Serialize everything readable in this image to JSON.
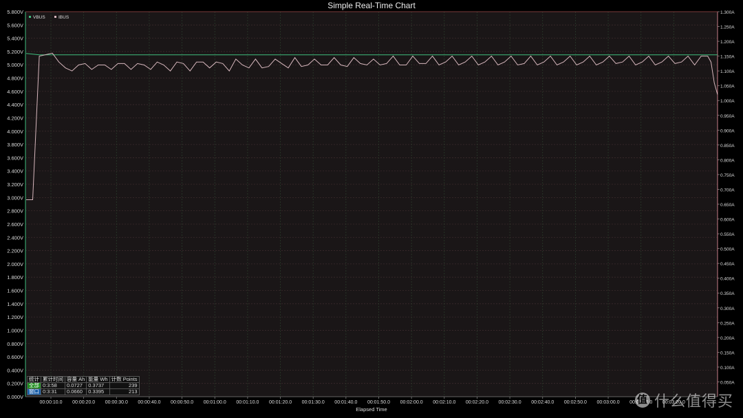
{
  "chart_data": {
    "type": "line",
    "title": "Simple Real-Time Chart",
    "xlabel": "Elapsed Time",
    "x_ticks": [
      "00:00:10.0",
      "00:00:20.0",
      "00:00:30.0",
      "00:00:40.0",
      "00:00:50.0",
      "00:01:00.0",
      "00:01:10.0",
      "00:01:20.0",
      "00:01:30.0",
      "00:01:40.0",
      "00:01:50.0",
      "00:02:00.0",
      "00:02:10.0",
      "00:02:20.0",
      "00:02:30.0",
      "00:02:40.0",
      "00:02:50.0",
      "00:03:00.0",
      "00:03:10.0",
      "00:03:20.0"
    ],
    "xlim": [
      0,
      211
    ],
    "left_axis": {
      "ylim": [
        0,
        5.8
      ],
      "ticks": [
        "0.000V",
        "0.200V",
        "0.400V",
        "0.600V",
        "0.800V",
        "1.000V",
        "1.200V",
        "1.400V",
        "1.600V",
        "1.800V",
        "2.000V",
        "2.200V",
        "2.400V",
        "2.600V",
        "2.800V",
        "3.000V",
        "3.200V",
        "3.400V",
        "3.600V",
        "3.800V",
        "4.000V",
        "4.200V",
        "4.400V",
        "4.600V",
        "4.800V",
        "5.000V",
        "5.200V",
        "5.400V",
        "5.600V",
        "5.800V"
      ]
    },
    "right_axis": {
      "ylim": [
        0,
        1.3
      ],
      "ticks": [
        "0.050A",
        "0.100A",
        "0.150A",
        "0.200A",
        "0.250A",
        "0.300A",
        "0.350A",
        "0.400A",
        "0.450A",
        "0.500A",
        "0.550A",
        "0.600A",
        "0.650A",
        "0.700A",
        "0.750A",
        "0.800A",
        "0.850A",
        "0.900A",
        "0.950A",
        "1.000A",
        "1.050A",
        "1.100A",
        "1.150A",
        "1.200A",
        "1.250A",
        "1.300A"
      ]
    },
    "grid": true,
    "legend_position": "top-left",
    "series": [
      {
        "name": "VBUS",
        "axis": "left",
        "color": "#3fbf7f",
        "x": [
          0,
          2,
          4,
          211
        ],
        "y": [
          5.17,
          5.16,
          5.15,
          5.15
        ]
      },
      {
        "name": "IBUS",
        "axis": "right",
        "color": "#d8b8be",
        "x": [
          0,
          2,
          4,
          6,
          8,
          10,
          12,
          14,
          16,
          18,
          20,
          22,
          24,
          26,
          28,
          30,
          32,
          34,
          36,
          38,
          40,
          42,
          44,
          46,
          48,
          50,
          52,
          54,
          56,
          58,
          60,
          62,
          64,
          66,
          68,
          70,
          72,
          74,
          76,
          78,
          80,
          82,
          84,
          86,
          88,
          90,
          92,
          94,
          96,
          98,
          100,
          102,
          104,
          106,
          108,
          110,
          112,
          114,
          116,
          118,
          120,
          122,
          124,
          126,
          128,
          130,
          132,
          134,
          136,
          138,
          140,
          142,
          144,
          146,
          148,
          150,
          152,
          154,
          156,
          158,
          160,
          162,
          164,
          166,
          168,
          170,
          172,
          174,
          176,
          178,
          180,
          182,
          184,
          186,
          188,
          190,
          192,
          194,
          196,
          198,
          200,
          202,
          204,
          206,
          208,
          209,
          210,
          211
        ],
        "y": [
          0.665,
          0.665,
          1.15,
          1.155,
          1.16,
          1.13,
          1.11,
          1.1,
          1.12,
          1.125,
          1.105,
          1.12,
          1.12,
          1.105,
          1.125,
          1.125,
          1.105,
          1.125,
          1.12,
          1.105,
          1.13,
          1.12,
          1.1,
          1.13,
          1.125,
          1.1,
          1.13,
          1.13,
          1.11,
          1.13,
          1.125,
          1.1,
          1.14,
          1.12,
          1.11,
          1.14,
          1.11,
          1.115,
          1.14,
          1.125,
          1.11,
          1.145,
          1.115,
          1.12,
          1.14,
          1.12,
          1.12,
          1.145,
          1.12,
          1.115,
          1.145,
          1.125,
          1.12,
          1.14,
          1.12,
          1.125,
          1.15,
          1.12,
          1.12,
          1.15,
          1.125,
          1.125,
          1.15,
          1.12,
          1.13,
          1.15,
          1.12,
          1.13,
          1.15,
          1.12,
          1.13,
          1.15,
          1.12,
          1.13,
          1.15,
          1.12,
          1.125,
          1.15,
          1.12,
          1.13,
          1.15,
          1.12,
          1.13,
          1.15,
          1.12,
          1.13,
          1.15,
          1.12,
          1.13,
          1.15,
          1.125,
          1.13,
          1.15,
          1.12,
          1.13,
          1.15,
          1.12,
          1.13,
          1.15,
          1.125,
          1.13,
          1.15,
          1.12,
          1.15,
          1.15,
          1.13,
          1.06,
          1.02
        ]
      }
    ],
    "stats_table": {
      "headers": [
        "统计",
        "累计时间",
        "容量 Ah",
        "能量 Wh",
        "计数 Points"
      ],
      "rows": [
        [
          "全部",
          "0:3:58",
          "0.0727",
          "0.3737",
          "239"
        ],
        [
          "窗口",
          "0:3:31",
          "0.0660",
          "0.3395",
          "213"
        ]
      ]
    }
  },
  "watermark": {
    "logo": "值",
    "text": "什么值得买"
  }
}
